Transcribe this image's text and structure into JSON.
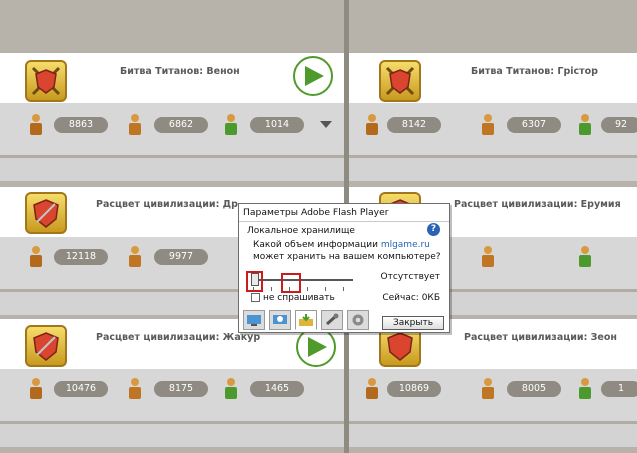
{
  "cards": [
    {
      "title": "Битва Титанов: Венон",
      "stats": [
        "8863",
        "6862",
        "1014"
      ]
    },
    {
      "title": "Битва Титанов: Грістор",
      "stats": [
        "8142",
        "6307",
        "92"
      ]
    },
    {
      "title": "Расцвет цивилизации: Др",
      "stats": [
        "12118",
        "9977",
        ""
      ]
    },
    {
      "title": "Расцвет цивилизации: Ерумия",
      "stats": [
        "",
        "",
        ""
      ]
    },
    {
      "title": "Расцвет цивилизации: Жакур",
      "stats": [
        "10476",
        "8175",
        "1465"
      ]
    },
    {
      "title": "Расцвет цивилизации: Зеон",
      "stats": [
        "10869",
        "8005",
        "1"
      ]
    }
  ],
  "flash_dialog": {
    "title": "Параметры Adobe Flash Player",
    "section": "Локальное хранилище",
    "question_line1_prefix": "Какой объем информации ",
    "question_site": "mlgame.ru",
    "question_line2": "может хранить на вашем компьютере?",
    "slider_value_label": "Отсутствует",
    "dont_ask_label": "не спрашивать",
    "current_label": "Сейчас: 0КБ",
    "close_button": "Закрыть",
    "help_symbol": "?"
  },
  "icons": {
    "emblem": "shield-swords-icon",
    "play": "play-icon",
    "figure": "character-icon",
    "dropdown": "chevron-down-icon"
  },
  "colors": {
    "play_green": "#4e9a2a",
    "emblem_gold": "#e0b43a",
    "highlight_red": "#cc1b1b",
    "link_blue": "#2466b5"
  }
}
